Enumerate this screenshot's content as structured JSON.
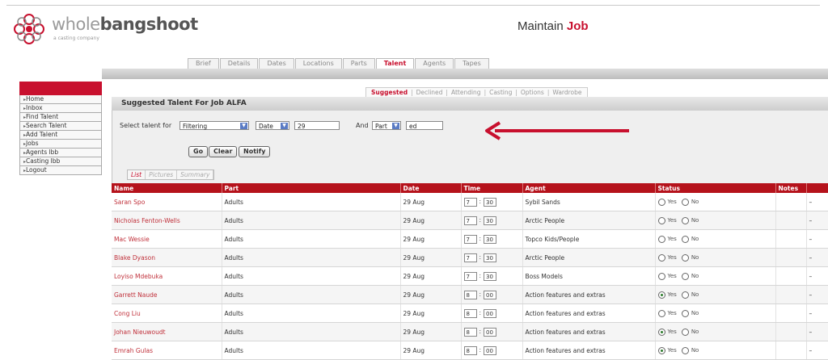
{
  "brand": {
    "name_light": "whole",
    "name_bold": "bangshoot",
    "tagline": "a casting company"
  },
  "page_title": {
    "prefix": "Maintain",
    "bold": "Job"
  },
  "main_tabs": [
    "Brief",
    "Details",
    "Dates",
    "Locations",
    "Parts",
    "Talent",
    "Agents",
    "Tapes"
  ],
  "main_tabs_active": "Talent",
  "sidebar": {
    "items": [
      "Home",
      "Inbox",
      "Find Talent",
      "Search Talent",
      "Add Talent",
      "Jobs",
      "Agents lbb",
      "Casting lbb",
      "Logout"
    ]
  },
  "sub_tabs": [
    "Suggested",
    "Declined",
    "Attending",
    "Casting",
    "Options",
    "Wardrobe"
  ],
  "sub_tabs_active": "Suggested",
  "panel": {
    "title": "Suggested Talent For Job ALFA"
  },
  "filter": {
    "label": "Select talent for",
    "criteria_select": "Filtering",
    "field_select": "Date",
    "field_value": "29",
    "joiner": "And",
    "field2_select": "Part",
    "field2_value": "ed"
  },
  "buttons": {
    "go": "Go",
    "clear": "Clear",
    "notify": "Notify"
  },
  "view_tabs": [
    "List",
    "Pictures",
    "Summary"
  ],
  "view_tabs_active": "List",
  "table": {
    "columns": [
      "Name",
      "Part",
      "Date",
      "Time",
      "Agent",
      "Status",
      "Notes",
      ""
    ],
    "radio_labels": {
      "yes": "Yes",
      "no": "No"
    },
    "rows": [
      {
        "name": "Saran Spo",
        "part": "Adults",
        "date": "29 Aug",
        "hour": "7",
        "minute": "30",
        "agent": "Sybil Sands",
        "status": "none"
      },
      {
        "name": "Nicholas Fenton-Wells",
        "part": "Adults",
        "date": "29 Aug",
        "hour": "7",
        "minute": "30",
        "agent": "Arctic People",
        "status": "none"
      },
      {
        "name": "Mac Wessie",
        "part": "Adults",
        "date": "29 Aug",
        "hour": "7",
        "minute": "30",
        "agent": "Topco Kids/People",
        "status": "none"
      },
      {
        "name": "Blake Dyason",
        "part": "Adults",
        "date": "29 Aug",
        "hour": "7",
        "minute": "30",
        "agent": "Arctic People",
        "status": "none"
      },
      {
        "name": "Loyiso Mdebuka",
        "part": "Adults",
        "date": "29 Aug",
        "hour": "7",
        "minute": "30",
        "agent": "Boss Models",
        "status": "none"
      },
      {
        "name": "Garrett Naude",
        "part": "Adults",
        "date": "29 Aug",
        "hour": "8",
        "minute": "00",
        "agent": "Action features and extras",
        "status": "yes"
      },
      {
        "name": "Cong Liu",
        "part": "Adults",
        "date": "29 Aug",
        "hour": "8",
        "minute": "00",
        "agent": "Action features and extras",
        "status": "none"
      },
      {
        "name": "Johan Nieuwoudt",
        "part": "Adults",
        "date": "29 Aug",
        "hour": "8",
        "minute": "00",
        "agent": "Action features and extras",
        "status": "yes"
      },
      {
        "name": "Emrah Gulas",
        "part": "Adults",
        "date": "29 Aug",
        "hour": "8",
        "minute": "00",
        "agent": "Action features and extras",
        "status": "yes"
      }
    ]
  }
}
